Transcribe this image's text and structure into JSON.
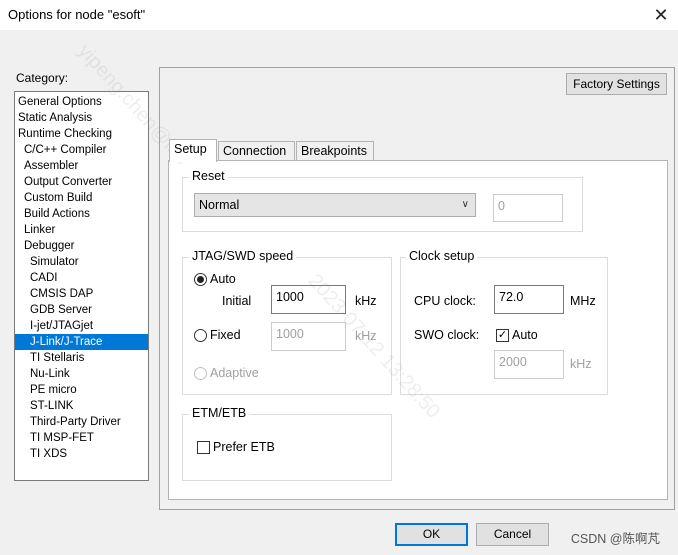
{
  "window": {
    "title": "Options for node \"esoft\"",
    "close_glyph": "✕"
  },
  "category": {
    "label": "Category:",
    "items": [
      {
        "label": "General Options",
        "indent": 0
      },
      {
        "label": "Static Analysis",
        "indent": 0
      },
      {
        "label": "Runtime Checking",
        "indent": 0
      },
      {
        "label": "C/C++ Compiler",
        "indent": 1
      },
      {
        "label": "Assembler",
        "indent": 1
      },
      {
        "label": "Output Converter",
        "indent": 1
      },
      {
        "label": "Custom Build",
        "indent": 1
      },
      {
        "label": "Build Actions",
        "indent": 1
      },
      {
        "label": "Linker",
        "indent": 1
      },
      {
        "label": "Debugger",
        "indent": 1
      },
      {
        "label": "Simulator",
        "indent": 2
      },
      {
        "label": "CADI",
        "indent": 2
      },
      {
        "label": "CMSIS DAP",
        "indent": 2
      },
      {
        "label": "GDB Server",
        "indent": 2
      },
      {
        "label": "I-jet/JTAGjet",
        "indent": 2
      },
      {
        "label": "J-Link/J-Trace",
        "indent": 2,
        "selected": true
      },
      {
        "label": "TI Stellaris",
        "indent": 2
      },
      {
        "label": "Nu-Link",
        "indent": 2
      },
      {
        "label": "PE micro",
        "indent": 2
      },
      {
        "label": "ST-LINK",
        "indent": 2
      },
      {
        "label": "Third-Party Driver",
        "indent": 2
      },
      {
        "label": "TI MSP-FET",
        "indent": 2
      },
      {
        "label": "TI XDS",
        "indent": 2
      }
    ]
  },
  "factory_settings_label": "Factory Settings",
  "tabs": [
    "Setup",
    "Connection",
    "Breakpoints"
  ],
  "reset": {
    "title": "Reset",
    "mode": "Normal",
    "delay_value": "0"
  },
  "jtag": {
    "title": "JTAG/SWD speed",
    "auto_label": "Auto",
    "initial_label": "Initial",
    "initial_value": "1000",
    "initial_unit": "kHz",
    "fixed_label": "Fixed",
    "fixed_value": "1000",
    "fixed_unit": "kHz",
    "adaptive_label": "Adaptive"
  },
  "clock": {
    "title": "Clock setup",
    "cpu_label": "CPU clock:",
    "cpu_value": "72.0",
    "cpu_unit": "MHz",
    "swo_label": "SWO clock:",
    "swo_auto_label": "Auto",
    "swo_auto_checked": true,
    "swo_value": "2000",
    "swo_unit": "kHz"
  },
  "etm": {
    "title": "ETM/ETB",
    "prefer_label": "Prefer ETB"
  },
  "buttons": {
    "ok": "OK",
    "cancel": "Cancel"
  },
  "watermark": {
    "line1": "yipeng.chen@ikd",
    "line2": "2023-07-12 13:28:50"
  },
  "csdn_tag": "CSDN @陈啊芃",
  "colors": {
    "selection": "#0078d7",
    "default_button_border": "#0078d7"
  }
}
